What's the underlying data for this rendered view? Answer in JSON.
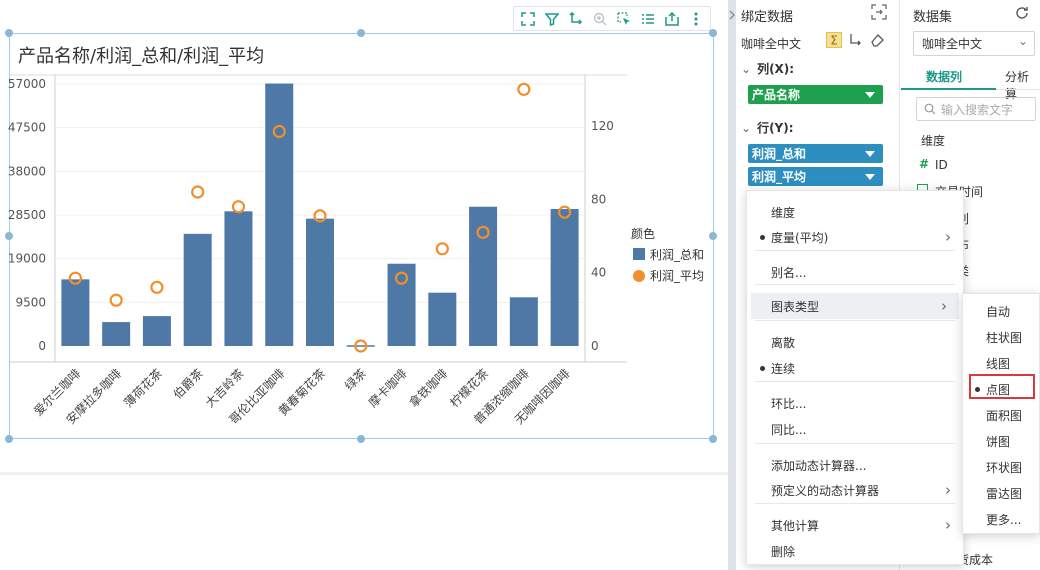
{
  "chart": {
    "title": "产品名称/利润_总和/利润_平均",
    "legend_title": "颜色",
    "legend_items": [
      "利润_总和",
      "利润_平均"
    ]
  },
  "chart_data": {
    "type": "bar",
    "categories": [
      "爱尔兰咖啡",
      "安摩拉多咖啡",
      "薄荷花茶",
      "伯爵茶",
      "大吉岭茶",
      "哥伦比亚咖啡",
      "黄春菊花茶",
      "绿茶",
      "摩卡咖啡",
      "拿铁咖啡",
      "柠檬花茶",
      "普通浓缩咖啡",
      "无咖啡因咖啡"
    ],
    "series": [
      {
        "name": "利润_总和",
        "type": "bar",
        "axis": "left",
        "color": "#4e79a7",
        "values": [
          14500,
          5200,
          6500,
          24400,
          29300,
          57100,
          27700,
          0,
          17900,
          11600,
          30300,
          10600,
          29800
        ]
      },
      {
        "name": "利润_平均",
        "type": "scatter",
        "axis": "right",
        "color": "#f28e2b",
        "values": [
          37,
          25,
          32,
          84,
          76,
          117,
          71,
          0,
          37,
          53,
          62,
          140,
          73
        ]
      }
    ],
    "yticks_left": [
      "57000",
      "47500",
      "38000",
      "28500",
      "19000",
      "9500",
      "0"
    ],
    "yticks_right": [
      "120",
      "80",
      "40",
      "0"
    ],
    "ylim_left": [
      0,
      57000
    ],
    "ylim_right": [
      0,
      150
    ],
    "grid": true,
    "legend_position": "right"
  },
  "toolbar": {
    "icons": [
      "expand-icon",
      "filter-icon",
      "drill-icon",
      "zoom-icon",
      "select-icon",
      "list-icon",
      "export-icon",
      "more-icon"
    ]
  },
  "bind_panel": {
    "title": "绑定数据",
    "source": "咖啡全中文",
    "columns_label": "列(X):",
    "rows_label": "行(Y):",
    "column_fields": [
      "产品名称"
    ],
    "row_fields": [
      "利润_总和",
      "利润_平均"
    ],
    "pill_colors": {
      "dimension": "#1ea04e",
      "measure": "#2c8fbf"
    }
  },
  "data_panel": {
    "title": "数据集",
    "dataset": "咖啡全中文",
    "tabs": [
      "数据列",
      "分析算"
    ],
    "search_placeholder": "输入搜索文字",
    "dimension_header": "维度",
    "fields": [
      "ID",
      "交易时间",
      "级别",
      "分布",
      "种类"
    ],
    "bottom_field": "出货成本"
  },
  "context_menu": {
    "items": [
      {
        "label": "维度",
        "dot": false,
        "sub": false
      },
      {
        "label": "度量(平均)",
        "dot": true,
        "sub": true
      },
      {
        "label": "别名...",
        "dot": false,
        "sub": false
      },
      {
        "label": "图表类型",
        "dot": false,
        "sub": true,
        "active": true
      },
      {
        "label": "离散",
        "dot": false,
        "sub": false
      },
      {
        "label": "连续",
        "dot": true,
        "sub": false
      },
      {
        "label": "环比...",
        "dot": false,
        "sub": false
      },
      {
        "label": "同比...",
        "dot": false,
        "sub": false
      },
      {
        "label": "添加动态计算器...",
        "dot": false,
        "sub": false
      },
      {
        "label": "预定义的动态计算器",
        "dot": false,
        "sub": true
      },
      {
        "label": "其他计算",
        "dot": false,
        "sub": true
      },
      {
        "label": "删除",
        "dot": false,
        "sub": false
      }
    ]
  },
  "chart_type_menu": {
    "items": [
      "自动",
      "柱状图",
      "线图",
      "点图",
      "面积图",
      "饼图",
      "环状图",
      "雷达图",
      "更多..."
    ],
    "selected": "点图"
  },
  "colors": {
    "accent": "#1b9a8a",
    "highlight": "#d9363e",
    "bar": "#4e79a7",
    "point": "#f28e2b"
  }
}
